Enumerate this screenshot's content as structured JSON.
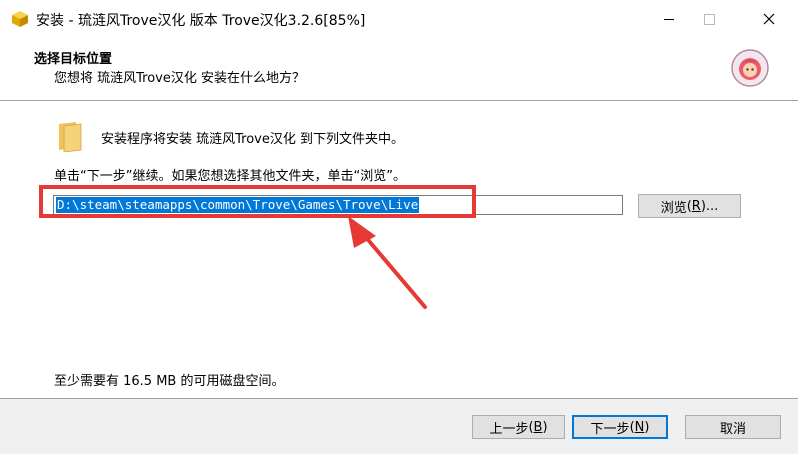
{
  "window": {
    "title": "安装 - 琉涟风Trove汉化 版本 Trove汉化3.2.6[85%]",
    "icon": "installer-box-icon",
    "controls": [
      "minimize-icon",
      "maximize-icon",
      "close-icon"
    ]
  },
  "header": {
    "title": "选择目标位置",
    "subtitle": "您想将 琉涟风Trove汉化 安装在什么地方？",
    "avatar_icon": "avatar-icon"
  },
  "main": {
    "info": "安装程序将安装 琉涟风Trove汉化 到下列文件夹中。",
    "hint": "单击“下一步”继续。如果您想选择其他文件夹，单击“浏览”。",
    "path_value": "D:\\steam\\steamapps\\common\\Trove\\Games\\Trove\\Live",
    "browse_label": "浏览",
    "browse_key": "R",
    "browse_suffix": "...",
    "disk_space": "至少需要有 16.5 MB 的可用磁盘空间。",
    "annotation_color": "#e53935"
  },
  "footer": {
    "back_label": "上一步",
    "back_key": "B",
    "next_label": "下一步",
    "next_key": "N",
    "cancel_label": "取消"
  }
}
